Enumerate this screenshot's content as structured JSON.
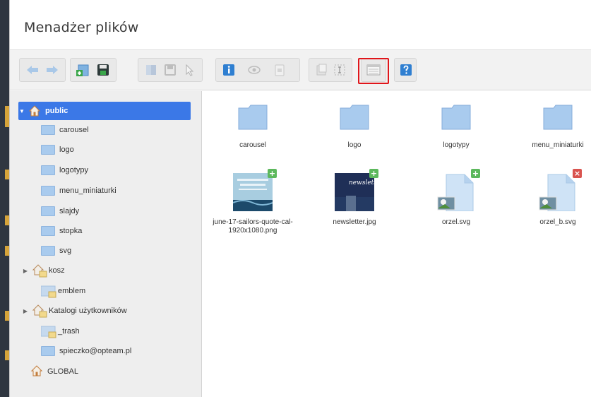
{
  "title": "Menadżer plików",
  "toolbar": {
    "buttons": [
      {
        "name": "back-icon"
      },
      {
        "name": "forward-icon"
      },
      {
        "name": "new-folder-icon"
      },
      {
        "name": "save-icon"
      },
      {
        "name": "copy-icon"
      },
      {
        "name": "paste-icon"
      },
      {
        "name": "select-icon"
      },
      {
        "name": "info-icon"
      },
      {
        "name": "preview-icon"
      },
      {
        "name": "properties-icon"
      },
      {
        "name": "duplicate-icon"
      },
      {
        "name": "rename-icon"
      },
      {
        "name": "list-view-icon"
      },
      {
        "name": "help-icon"
      }
    ]
  },
  "tree": {
    "root_selected": "public",
    "items": [
      {
        "label": "public"
      },
      {
        "label": "carousel"
      },
      {
        "label": "logo"
      },
      {
        "label": "logotypy"
      },
      {
        "label": "menu_miniaturki"
      },
      {
        "label": "slajdy"
      },
      {
        "label": "stopka"
      },
      {
        "label": "svg"
      },
      {
        "label": "kosz"
      },
      {
        "label": "emblem"
      },
      {
        "label": "Katalogi użytkowników"
      },
      {
        "label": "_trash"
      },
      {
        "label": "spieczko@opteam.pl"
      },
      {
        "label": "GLOBAL"
      }
    ]
  },
  "files": [
    {
      "name": "carousel",
      "kind": "folder"
    },
    {
      "name": "logo",
      "kind": "folder"
    },
    {
      "name": "logotypy",
      "kind": "folder"
    },
    {
      "name": "menu_miniaturki",
      "kind": "folder"
    },
    {
      "name": "june-17-sailors-quote-cal-1920x1080.png",
      "kind": "image"
    },
    {
      "name": "newsletter.jpg",
      "kind": "image",
      "thumb_text": "newslette"
    },
    {
      "name": "orzel.svg",
      "kind": "svg"
    },
    {
      "name": "orzel_b.svg",
      "kind": "svg"
    }
  ],
  "colors": {
    "selected": "#3b78e7",
    "highlight": "#e0161b",
    "folder": "#a9cbee"
  }
}
